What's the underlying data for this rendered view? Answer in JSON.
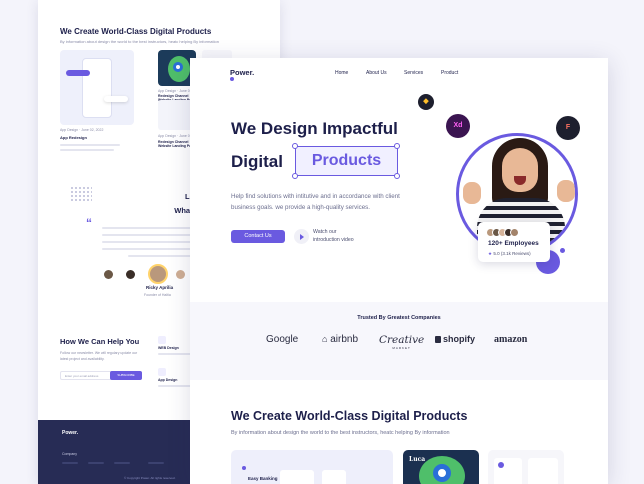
{
  "back": {
    "heading": "We Create World-Class Digital Products",
    "subheading": "By information about design the world to the best instructors, heatc helping By information",
    "case1_meta": "App Design · June 02, 2022",
    "case1_title": "App Redesign",
    "case2_meta": "App Design · June 09, 2022",
    "case2_title": "Redesign Channel Website Landing Page",
    "case3_meta": "App Design · June 09, 2022",
    "case3_title": "Redesign Channel Website Landing Page",
    "testimonial_title_1": "Let's Hear",
    "testimonial_title_2": "What They Says",
    "reviewer_name": "Ricky Aprilia",
    "reviewer_role": "Founder of Haltia",
    "help_title": "How We Can Help You",
    "help_desc": "Follow our newsletter. We will regulary update our latest project and availability.",
    "email_placeholder": "Enter your email address",
    "subscribe_label": "SUBSCRIBE",
    "service1": "WEB Design",
    "service2": "App Design",
    "footer_logo": "Power.",
    "footer_company": "Company",
    "footer_copyright": "© Copyright Power. All rights reserved."
  },
  "front": {
    "logo": "Power.",
    "nav": [
      "Home",
      "About Us",
      "Services",
      "Product"
    ],
    "headline_line1": "We Design Impactful",
    "headline_line2_prefix": "Digital",
    "headline_highlight": "Products",
    "description": "Help find solutions with intitutive and in accordance with client business goals. we provide a high-quality services.",
    "cta_label": "Contact Us",
    "watch_label_line1": "Watch our",
    "watch_label_line2": "introduction video",
    "badge_xd": "Xd",
    "badge_figma": "F",
    "badge_sketch": "◆",
    "employees_title": "120+ Employees",
    "rating_text": "5.0 (3.1k Reviews)",
    "trusted_title": "Trusted By Greatest Companies",
    "companies": [
      "Google",
      "airbnb",
      "Creative",
      "shopify",
      "amazon"
    ],
    "creative_sub": "MARKET",
    "section_title": "We Create World-Class Digital Products",
    "section_sub": "By information about design  the world to the best instructors, heatc helping By information",
    "card1_label": "Easy Banking",
    "card2_label": "Luca"
  },
  "colors": {
    "accent": "#6a5ae0",
    "text_dark": "#1d1f4a",
    "footer_bg": "#272c55",
    "background": "#f4f4fb"
  }
}
